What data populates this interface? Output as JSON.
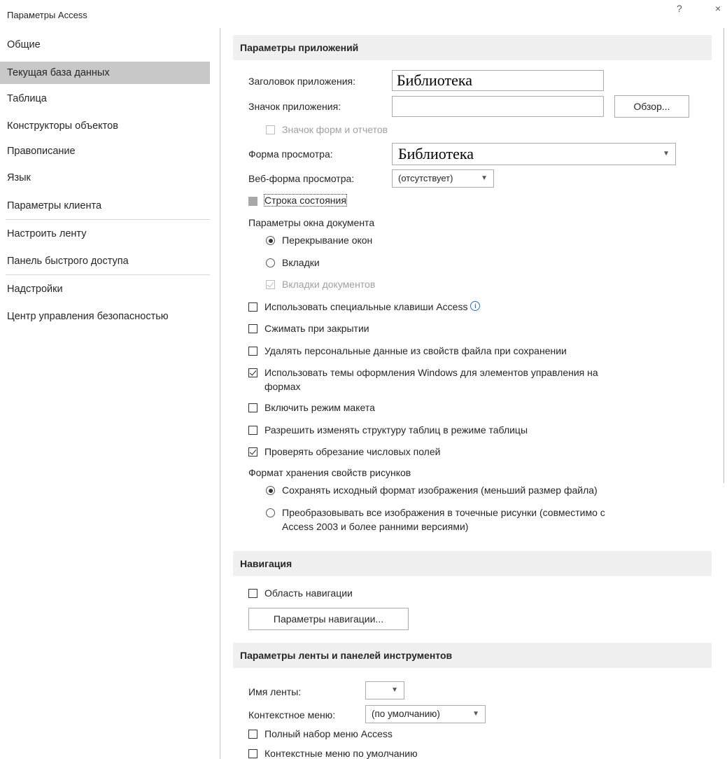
{
  "window": {
    "title": "Параметры Access"
  },
  "sidebar": {
    "items": [
      {
        "label": "Общие"
      },
      {
        "label": "Текущая база данных"
      },
      {
        "label": "Таблица"
      },
      {
        "label": "Конструкторы объектов"
      },
      {
        "label": "Правописание"
      },
      {
        "label": "Язык"
      },
      {
        "label": "Параметры клиента"
      },
      {
        "label": "Настроить ленту"
      },
      {
        "label": "Панель быстрого доступа"
      },
      {
        "label": "Надстройки"
      },
      {
        "label": "Центр управления безопасностью"
      }
    ],
    "selected": "Текущая база данных"
  },
  "app_options": {
    "heading": "Параметры приложений",
    "app_title_label": "Заголовок приложения:",
    "app_title_value": "Библиотека",
    "app_icon_label": "Значок приложения:",
    "app_icon_value": "",
    "browse_button": "Обзор...",
    "forms_reports_icon_label": "Значок форм и отчетов",
    "display_form_label": "Форма просмотра:",
    "display_form_value": "Библиотека",
    "web_form_label": "Веб-форма просмотра:",
    "web_form_value": "(отсутствует)",
    "status_bar_label": "Строка состояния",
    "doc_window_options_label": "Параметры окна документа",
    "overlapping_windows_label": "Перекрывание окон",
    "tabbed_documents_label": "Вкладки",
    "document_tabs_label": "Вкладки документов",
    "special_keys_label": "Использовать специальные клавиши Access",
    "compact_on_close_label": "Сжимать при закрытии",
    "remove_personal_info_label": "Удалять персональные данные из свойств файла при сохранении",
    "windows_themes_label_line1": "Использовать темы оформления Windows для элементов управления на",
    "windows_themes_label_line2": "формах",
    "layout_view_label": "Включить режим макета",
    "design_changes_label": "Разрешить изменять структуру таблиц в режиме таблицы",
    "truncated_fields_label": "Проверять обрезание числовых полей",
    "picture_format_label": "Формат хранения свойств рисунков",
    "preserve_format_label": "Сохранять исходный формат изображения (меньший размер файла)",
    "convert_bitmaps_label_line1": "Преобразовывать все изображения в точечные рисунки (совместимо с",
    "convert_bitmaps_label_line2": "Access 2003 и более ранними версиями)"
  },
  "navigation": {
    "heading": "Навигация",
    "nav_pane_label": "Область навигации",
    "nav_options_button": "Параметры навигации..."
  },
  "ribbon": {
    "heading": "Параметры ленты и панелей инструментов",
    "ribbon_name_label": "Имя ленты:",
    "ribbon_name_value": "",
    "shortcut_menu_label": "Контекстное меню:",
    "shortcut_menu_value": "(по умолчанию)",
    "full_menus_label": "Полный набор меню Access",
    "default_shortcut_menus_label": "Контекстные меню по умолчанию"
  }
}
